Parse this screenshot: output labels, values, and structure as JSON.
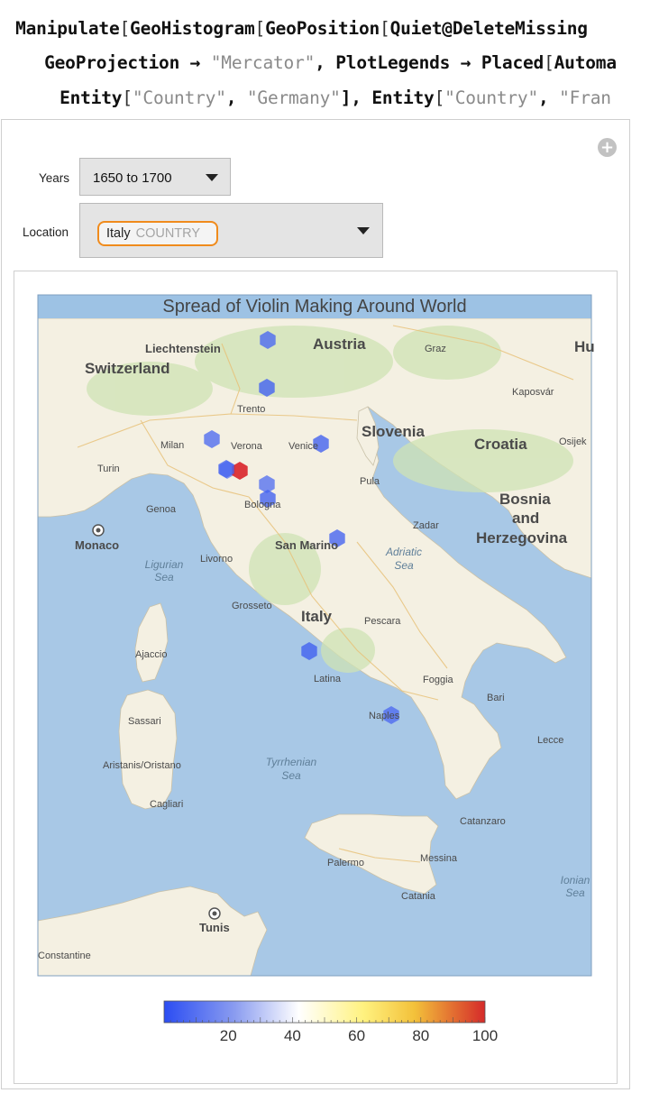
{
  "code": {
    "line1": [
      "Manipulate",
      "[",
      "GeoHistogram",
      "[",
      "GeoPosition",
      "[",
      "Quiet@DeleteMissing"
    ],
    "line2": [
      "GeoProjection",
      " → ",
      "\"Mercator\"",
      ", ",
      "PlotLegends",
      " → ",
      "Placed",
      "[",
      "Automa"
    ],
    "line3": [
      "Entity",
      "[",
      "\"Country\"",
      ", ",
      "\"Germany\"",
      "], ",
      "Entity",
      "[",
      "\"Country\"",
      ", ",
      "\"Fran"
    ]
  },
  "panel": {
    "add_icon": "plus-circle-icon",
    "years": {
      "label": "Years",
      "value": "1650 to 1700"
    },
    "location": {
      "label": "Location",
      "entity_name": "Italy",
      "entity_type": "COUNTRY"
    }
  },
  "map": {
    "title": "Spread of Violin Making Around World",
    "colors": {
      "sea": "#a8c8e6",
      "land": "#f4f0e2",
      "title_bar": "#9dc2e4",
      "low": "#3c5cf0",
      "high": "#d9242a"
    },
    "countries": [
      "Austria",
      "Switzerland",
      "Liechtenstein",
      "Slovenia",
      "Croatia",
      "Bosnia",
      "and",
      "Herzegovina",
      "Italy",
      "San Marino",
      "Monaco"
    ],
    "seas": [
      "Ligurian",
      "Sea",
      "Adriatic",
      "Sea",
      "Tyrrhenian",
      "Sea",
      "Ionian",
      "Sea"
    ],
    "cities": [
      "Graz",
      "Kaposvár",
      "Osijek",
      "Trento",
      "Milan",
      "Verona",
      "Venice",
      "Turin",
      "Pula",
      "Genoa",
      "Bologna",
      "Zadar",
      "Livorno",
      "Grosseto",
      "Pescara",
      "Ajaccio",
      "Latina",
      "Foggia",
      "Bari",
      "Sassari",
      "Naples",
      "Lecce",
      "Aristanis/Oristano",
      "Cagliari",
      "Catanzaro",
      "Palermo",
      "Messina",
      "Catania",
      "Tunis",
      "Constantine",
      "Hu"
    ]
  },
  "chart_data": {
    "type": "heatmap",
    "title": "Spread of Violin Making Around World",
    "legend": {
      "ticks": [
        20,
        40,
        60,
        80,
        100
      ],
      "range": [
        0,
        100
      ]
    },
    "bins": [
      {
        "near": "Innsbruck",
        "value": 8
      },
      {
        "near": "Trento",
        "value": 5
      },
      {
        "near": "Milan",
        "value": 10
      },
      {
        "near": "Brescia",
        "value": 5
      },
      {
        "near": "Venice",
        "value": 18
      },
      {
        "near": "Cremona",
        "value": 100
      },
      {
        "near": "Mantua",
        "value": 12
      },
      {
        "near": "Bologna",
        "value": 5
      },
      {
        "near": "Bologna",
        "value": 6
      },
      {
        "near": "San Marino",
        "value": 4
      },
      {
        "near": "Rome",
        "value": 9
      },
      {
        "near": "Naples",
        "value": 6
      }
    ]
  }
}
